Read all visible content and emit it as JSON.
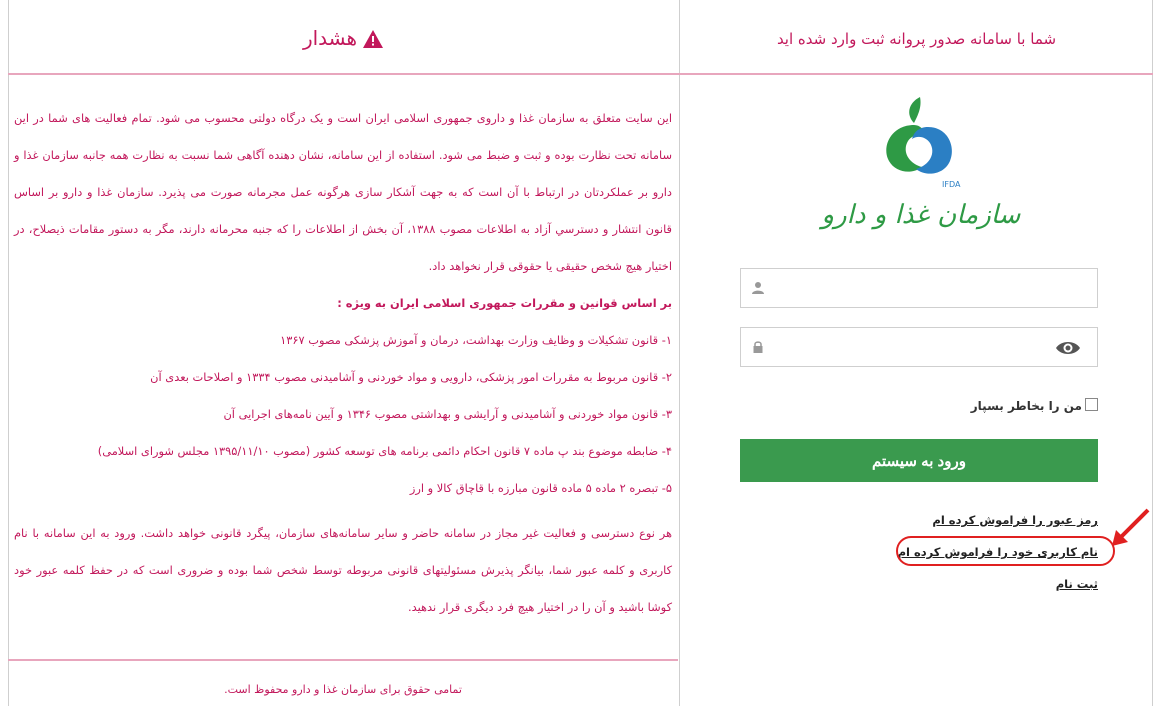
{
  "warning": {
    "title": "هشدار",
    "icon": "warning-triangle-icon",
    "paragraphs": [
      "این سایت متعلق به سازمان غذا و داروی جمهوری اسلامی ایران است و یک درگاه دولتی محسوب می شود. تمام فعالیت های شما در این سامانه تحت نظارت بوده و ثبت و ضبط می شود. استفاده از این سامانه، نشان دهنده آگاهی شما نسبت به نظارت همه جانبه سازمان غذا و دارو بر عملکردتان در ارتباط با آن است که به جهت آشکار سازی هرگونه عمل مجرمانه صورت می پذیرد. سازمان غذا و دارو بر اساس قانون انتشار و دسترسي آزاد به اطلاعات مصوب ۱۳۸۸، آن بخش از اطلاعات را كه جنبه محرمانه دارند، مگر به دستور مقامات ذیصلاح، در اختیار هیچ شخص حقیقی یا حقوقی قرار نخواهد داد."
    ],
    "laws_heading": "بر اساس قوانین و مقررات جمهوری اسلامی ایران به ویژه :",
    "laws": [
      "۱- قانون تشکیلات و وظایف وزارت بهداشت، درمان و آموزش پزشکی مصوب ۱۳۶۷",
      "۲- قانون مربوط به مقررات امور پزشکی، دارویی و مواد خوردنی و آشامیدنی مصوب ۱۳۳۴ و اصلاحات بعدی آن",
      "۳- قانون مواد خوردنی و آشامیدنی و آرایشی و بهداشتی مصوب ۱۳۴۶ و آیین نامه‌های اجرایی آن",
      "۴- ضابطه موضوع بند پ  ماده ۷ قانون احکام دائمی برنامه های توسعه کشور (مصوب ۱۳۹۵/۱۱/۱۰ مجلس شورای اسلامی)",
      "۵- تبصره ۲ ماده ۵ ماده قانون مبارزه با قاچاق کالا و ارز"
    ],
    "closing": "هر نوع دسترسی و فعالیت غیر مجاز در سامانه حاضر و سایر سامانه‌های سازمان، پیگرد قانونی خواهد داشت. ورود به این سامانه با نام کاربری و کلمه عبور شما، بیانگر پذیرش مسئولیتهای قانونی مربوطه توسط شخص شما بوده و ضروری است که در حفظ کلمه عبور خود کوشا باشید و آن را در اختیار هیچ فرد دیگری قرار ندهید.",
    "footer": "تمامی حقوق برای سازمان غذا و دارو محفوظ است."
  },
  "login": {
    "title": "شما با سامانه صدور پروانه ثبت وارد شده اید",
    "logo": {
      "icon": "ifda-logo",
      "abbr": "IFDA",
      "name": "سازمان غذا و دارو",
      "colors": {
        "green": "#2e9a45",
        "blue": "#2b7fc4"
      }
    },
    "username_icon": "user-icon",
    "password_icon": "lock-icon",
    "show_password_icon": "eye-icon",
    "remember_label": "من را بخاطر بسپار",
    "submit_label": "ورود به سیستم",
    "links": {
      "forgot_password": "رمز عبور را فراموش کرده ام",
      "forgot_username": "نام کاربری خود را فراموش کرده ام",
      "register": "ثبت نام"
    }
  },
  "colors": {
    "accent": "#c2185b",
    "divider": "#e8a6bd",
    "button": "#3a9a4e",
    "highlight": "#e02020"
  }
}
